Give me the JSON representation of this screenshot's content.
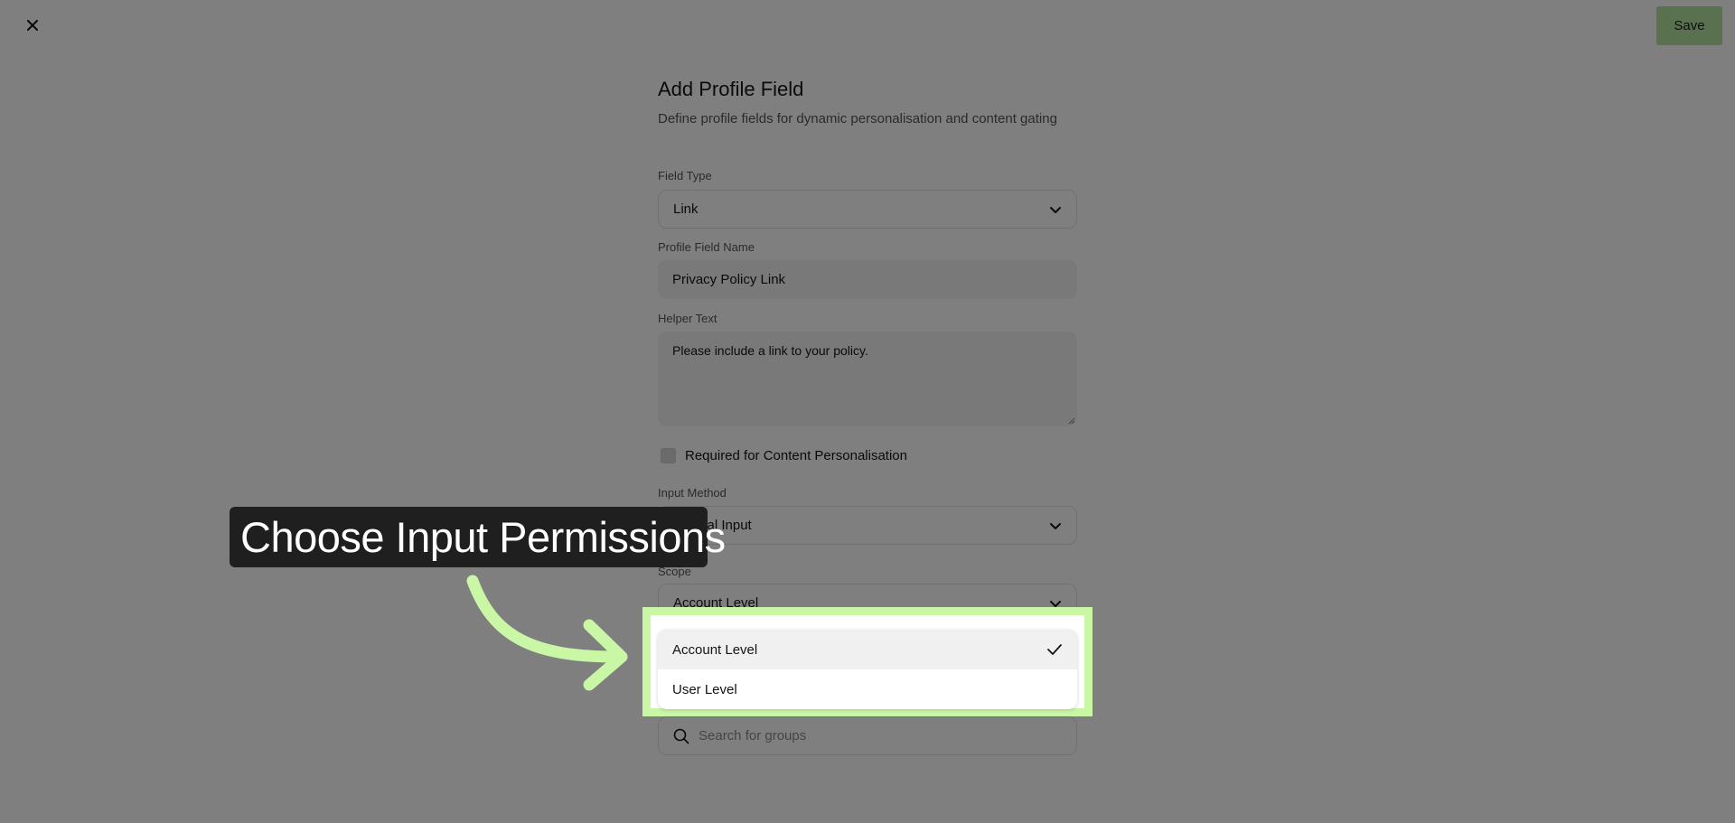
{
  "header": {
    "close_icon": "close-icon",
    "save_label": "Save"
  },
  "form": {
    "title": "Add Profile Field",
    "subtitle": "Define profile fields for dynamic personalisation and content gating",
    "field_type": {
      "label": "Field Type",
      "value": "Link"
    },
    "profile_field_name": {
      "label": "Profile Field Name",
      "value": "Privacy Policy Link"
    },
    "helper_text": {
      "label": "Helper Text",
      "value": "Please include a link to your policy."
    },
    "required_checkbox": {
      "label": "Required for Content Personalisation",
      "checked": false
    },
    "input_method": {
      "label": "Input Method",
      "value": "Manual Input"
    },
    "scope": {
      "label": "Scope",
      "value": "Account Level"
    },
    "group_search": {
      "placeholder": "Search for groups"
    }
  },
  "scope_dropdown": {
    "options": [
      {
        "label": "Account Level",
        "selected": true
      },
      {
        "label": "User Level",
        "selected": false
      }
    ]
  },
  "tutorial": {
    "callout_text": "Choose Input Permissions",
    "highlight_color": "#c9f7a5"
  },
  "colors": {
    "save_button": "#b5e3a0",
    "callout_bg": "#1f1f1f"
  }
}
